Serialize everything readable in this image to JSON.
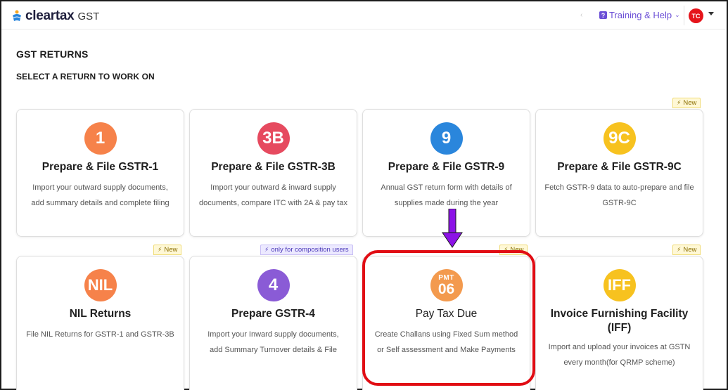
{
  "header": {
    "logo_text": "cleartax",
    "logo_suffix": "GST",
    "help_label": "Training & Help",
    "help_icon": "question-icon",
    "avatar_initials": "TC"
  },
  "page": {
    "title": "GST RETURNS",
    "subtitle": "SELECT A RETURN TO WORK ON"
  },
  "cards": [
    {
      "icon": "1",
      "name": "Prepare & File GSTR-1",
      "desc1": "Import your outward supply documents,",
      "desc2": "add summary details and complete filing",
      "color": "#f6824a"
    },
    {
      "icon": "3B",
      "name": "Prepare & File GSTR-3B",
      "desc1": "Import your outward & inward supply",
      "desc2": "documents, compare ITC with 2A & pay tax",
      "color": "#e64a5f"
    },
    {
      "icon": "9",
      "name": "Prepare & File GSTR-9",
      "desc1": "Annual GST return form with details of",
      "desc2": "supplies made during the year",
      "color": "#2a86dc"
    },
    {
      "icon": "9C",
      "name": "Prepare & File GSTR-9C",
      "desc1": "Fetch GSTR-9 data to auto-prepare and file",
      "desc2": "GSTR-9C",
      "color": "#f7c21f"
    },
    {
      "icon": "NIL",
      "name": "NIL Returns",
      "desc1": "File NIL Returns for GSTR-1 and GSTR-3B",
      "desc2": "",
      "color": "#f6824a"
    },
    {
      "icon": "4",
      "name": "Prepare GSTR-4",
      "desc1": "Import your Inward supply documents,",
      "desc2": "add Summary Turnover details & File",
      "color": "#8a5bd6"
    },
    {
      "icon_top": "PMT",
      "icon": "06",
      "name": "Pay Tax Due",
      "desc1": "Create Challans using Fixed Sum method",
      "desc2": "or Self assessment and Make Payments",
      "color": "#f39a4e"
    },
    {
      "icon": "IFF",
      "name": "Invoice Furnishing Facility (IFF)",
      "desc1": "Import and upload your invoices at GSTN",
      "desc2": "every month(for QRMP scheme)",
      "color": "#f7c21f"
    }
  ],
  "badges": {
    "new": "New",
    "composition": "only for composition users"
  },
  "annotation": {
    "arrow_color": "#8c12e6",
    "highlight_color": "#e10d14"
  }
}
